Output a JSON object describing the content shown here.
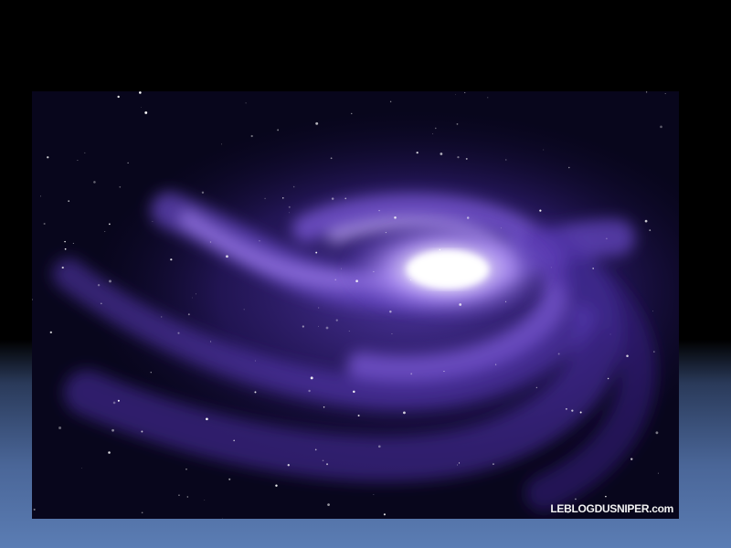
{
  "image": {
    "subject": "spiral galaxy",
    "watermark": "LEBLOGDUSNIPER.com",
    "colors": {
      "core": "#ffffff",
      "arm": "#7a55d8",
      "deep": "#2a1860",
      "space": "#07051a"
    }
  }
}
